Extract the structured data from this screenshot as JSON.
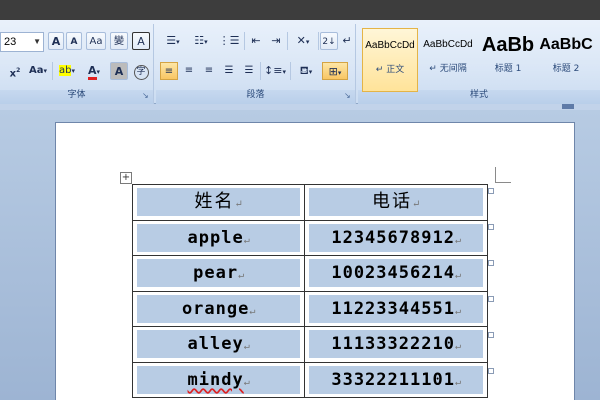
{
  "ribbon": {
    "font_group": {
      "label": "字体",
      "font_size": "23",
      "grow_font": "A",
      "shrink_font": "A",
      "clear_format": "Aa",
      "phonetic": "變",
      "char_border": "A",
      "subscript": "x",
      "change_case": "Aa",
      "highlight": "ab",
      "font_color": "A",
      "char_shading": "A",
      "enclose": "字"
    },
    "paragraph_group": {
      "label": "段落",
      "sort": "2↓",
      "show_marks": "↵"
    },
    "styles_group": {
      "label": "样式",
      "items": [
        {
          "preview": "AaBbCcDd",
          "name": "↵ 正文"
        },
        {
          "preview": "AaBbCcDd",
          "name": "↵ 无间隔"
        },
        {
          "preview": "AaBb",
          "name": "标题 1"
        },
        {
          "preview": "AaBbC",
          "name": "标题 2"
        }
      ]
    }
  },
  "table": {
    "headers": [
      "姓名",
      "电话"
    ],
    "rows": [
      {
        "name": "apple",
        "phone": "12345678912"
      },
      {
        "name": "pear",
        "phone": "10023456214"
      },
      {
        "name": "orange",
        "phone": "11223344551"
      },
      {
        "name": "alley",
        "phone": "11133322210"
      },
      {
        "name": "mindy",
        "phone": "33322211101"
      }
    ],
    "paragraph_mark": "↵"
  },
  "colors": {
    "cell_fill": "#b8cce4",
    "selected_style": "#ffe39a",
    "ribbon": "#dbe7f6"
  }
}
